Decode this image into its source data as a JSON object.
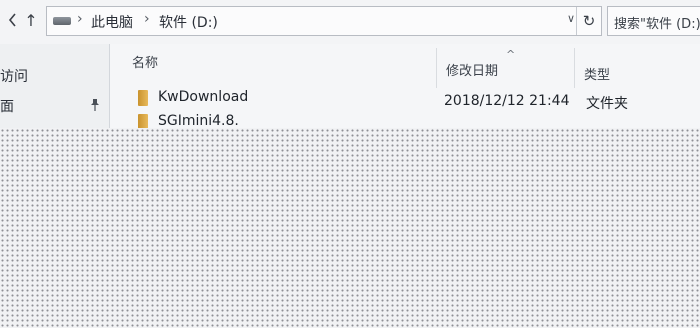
{
  "window": {
    "bg": "#eef0f2"
  },
  "nav": {
    "up_arrow": "↑",
    "back_icon": "chevron-left-icon",
    "breadcrumb": [
      "此电脑",
      "软件 (D:)"
    ],
    "separator": "›",
    "dropdown": "∨",
    "refresh": "↻"
  },
  "search": {
    "placeholder": "搜索\"软件 (D:)\""
  },
  "sidebar": {
    "items": [
      {
        "label": "访问"
      },
      {
        "label": "面"
      }
    ]
  },
  "columns": {
    "name": "名称",
    "modified": "修改日期",
    "type": "类型",
    "sort_indicator": "^"
  },
  "files": [
    {
      "name": "KwDownload",
      "modified": "2018/12/12 21:44",
      "type": "文件夹"
    },
    {
      "name": "SGImini4.8.",
      "modified": "",
      "type": ""
    }
  ]
}
